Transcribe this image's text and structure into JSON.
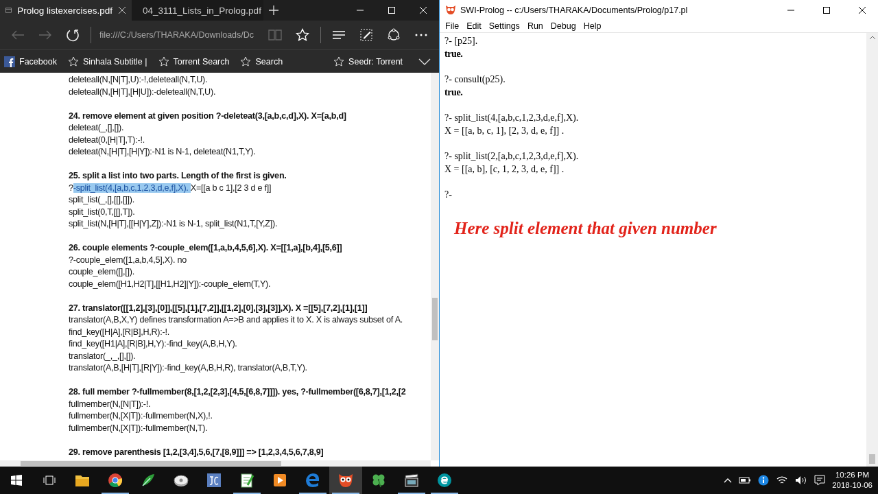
{
  "browser": {
    "tabs": [
      {
        "title": "Prolog listexercises.pdf",
        "selected": true
      },
      {
        "title": "04_3111_Lists_in_Prolog.pdf",
        "selected": false
      }
    ],
    "address": "file:///C:/Users/THARAKA/Downloads/Dc",
    "favorites": [
      {
        "label": "Facebook",
        "kind": "facebook"
      },
      {
        "label": "Sinhala Subtitle |",
        "kind": "star"
      },
      {
        "label": "Torrent Search",
        "kind": "star"
      },
      {
        "label": "Search",
        "kind": "star"
      },
      {
        "label": "Seedr: Torrent",
        "kind": "star"
      }
    ],
    "document": [
      {
        "lines": [
          {
            "text": "deleteall(N,[N|T],U):-!,deleteall(N,T,U)."
          },
          {
            "text": "deleteall(N,[H|T],[H|U]):-deleteall(N,T,U)."
          }
        ]
      },
      {
        "heading": "24. remove element at given position ?-deleteat(3,[a,b,c,d],X). X=[a,b,d]",
        "lines": [
          {
            "text": "deleteat(_,[],[])."
          },
          {
            "text": "deleteat(0,[H|T],T):-!."
          },
          {
            "text": "deleteat(N,[H|T],[H|Y]):-N1 is N-1, deleteat(N1,T,Y)."
          }
        ]
      },
      {
        "heading": "25. split a list into two parts. Length of the first is given.",
        "lines": [
          {
            "text": "?",
            "highlight": "-split_list(4,[a,b,c,1,2,3,d,e,f],X). ",
            "after": "X=[[a b c 1],[2 3 d e f]]"
          },
          {
            "text": "split_list(_,[],[[],[]])."
          },
          {
            "text": "split_list(0,T,[[],T])."
          },
          {
            "text": "split_list(N,[H|T],[[H|Y],Z]):-N1 is N-1, split_list(N1,T,[Y,Z])."
          }
        ]
      },
      {
        "heading": "26. couple elements ?-couple_elem([1,a,b,4,5,6],X). X=[[1,a],[b,4],[5,6]]",
        "lines": [
          {
            "text": "?-couple_elem([1,a,b,4,5],X). no"
          },
          {
            "text": "couple_elem([],[])."
          },
          {
            "text": "couple_elem([H1,H2|T],[[H1,H2]|Y]):-couple_elem(T,Y)."
          }
        ]
      },
      {
        "heading": "27. translator([[1,2],[3],[0]],[[5],[1],[7,2]],[[1,2],[0],[3],[3]],X). X =[[5],[7,2],[1],[1]]",
        "lines": [
          {
            "text": "translator(A,B,X,Y) defines transformation A=>B and applies it to X. X is always subset of A."
          },
          {
            "text": "find_key([H|A],[R|B],H,R):-!."
          },
          {
            "text": "find_key([H1|A],[R|B],H,Y):-find_key(A,B,H,Y)."
          },
          {
            "text": "translator(_,_,[],[])."
          },
          {
            "text": "translator(A,B,[H|T],[R|Y]):-find_key(A,B,H,R), translator(A,B,T,Y)."
          }
        ]
      },
      {
        "heading": "28. full member ?-fullmember(8,[1,2,[2,3],[4,5,[6,8,7]]]). yes, ?-fullmember([6,8,7],[1,2,[2",
        "lines": [
          {
            "text": "fullmember(N,[N|T]):-!."
          },
          {
            "text": "fullmember(N,[X|T]):-fullmember(N,X),!."
          },
          {
            "text": "fullmember(N,[X|T]):-fullmember(N,T)."
          }
        ]
      },
      {
        "heading": "29. remove parenthesis [1,2,[3,4],5,6,[7,[8,9]]] => [1,2,3,4,5,6,7,8,9]"
      }
    ]
  },
  "prolog": {
    "title": "SWI-Prolog -- c:/Users/THARAKA/Documents/Prolog/p17.pl",
    "menu": [
      "File",
      "Edit",
      "Settings",
      "Run",
      "Debug",
      "Help"
    ],
    "exchanges": [
      {
        "query": "?- [p25].",
        "answer": "true.",
        "kind": "boolean"
      },
      {
        "query": "?- consult(p25).",
        "answer": "true.",
        "kind": "boolean"
      },
      {
        "query": "?- split_list(4,[a,b,c,1,2,3,d,e,f],X).",
        "answer": "X = [[a, b, c, 1], [2, 3, d, e, f]] .",
        "kind": "binding"
      },
      {
        "query": "?- split_list(2,[a,b,c,1,2,3,d,e,f],X).",
        "answer": "X = [[a, b], [c, 1, 2, 3, d, e, f]] .",
        "kind": "binding"
      }
    ],
    "prompt": "?-",
    "annotation": "Here split element that given number"
  },
  "taskbar": {
    "apps": [
      {
        "kind": "explorer",
        "running": false,
        "selected": false
      },
      {
        "kind": "chrome",
        "running": true,
        "selected": false
      },
      {
        "kind": "leaf",
        "running": false,
        "selected": false
      },
      {
        "kind": "disk",
        "running": false,
        "selected": false
      },
      {
        "kind": "jc",
        "running": false,
        "selected": false
      },
      {
        "kind": "notepad",
        "running": true,
        "selected": false
      },
      {
        "kind": "media",
        "running": false,
        "selected": false
      },
      {
        "kind": "edge",
        "running": true,
        "selected": false
      },
      {
        "kind": "owl",
        "running": true,
        "selected": true
      },
      {
        "kind": "clover",
        "running": false,
        "selected": false
      },
      {
        "kind": "clapper",
        "running": true,
        "selected": false
      },
      {
        "kind": "eset",
        "running": true,
        "selected": false
      }
    ],
    "time": "10:26 PM",
    "date": "2018-10-06"
  }
}
